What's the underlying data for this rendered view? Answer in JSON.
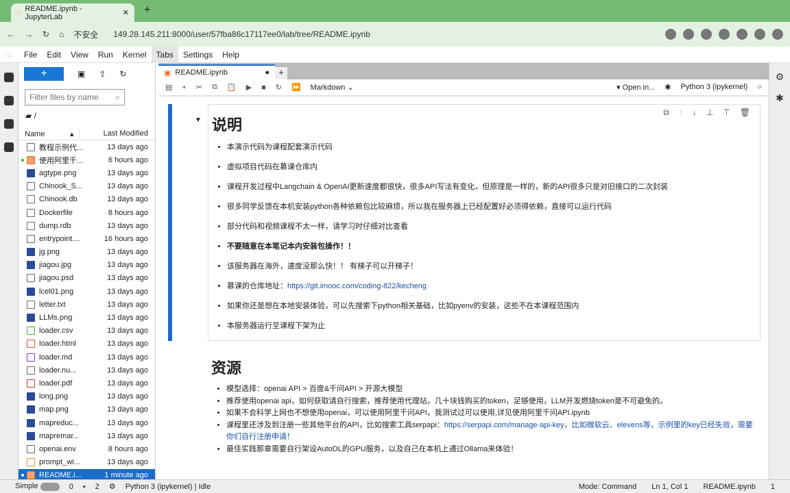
{
  "browser": {
    "tab_title": "README.ipynb - JupyterLab",
    "url": "149.28.145.211:8000/user/57fba86c17117ee0/lab/tree/README.ipynb",
    "security": "不安全"
  },
  "menu": [
    "File",
    "Edit",
    "View",
    "Run",
    "Kernel",
    "Tabs",
    "Settings",
    "Help"
  ],
  "filebrowser": {
    "new_label": "+",
    "filter_placeholder": "Filter files by name",
    "path": "/",
    "col_name": "Name",
    "col_modified": "Last Modified",
    "files": [
      {
        "name": "教程示例代...",
        "modified": "13 days ago",
        "type": "file"
      },
      {
        "name": "使用阿里千...",
        "modified": "6 hours ago",
        "type": "nb",
        "running": true
      },
      {
        "name": "agtype.png",
        "modified": "13 days ago",
        "type": "img"
      },
      {
        "name": "Chinook_S...",
        "modified": "13 days ago",
        "type": "file"
      },
      {
        "name": "Chinook.db",
        "modified": "13 days ago",
        "type": "file"
      },
      {
        "name": "Dockerfile",
        "modified": "8 hours ago",
        "type": "file"
      },
      {
        "name": "dump.rdb",
        "modified": "13 days ago",
        "type": "file"
      },
      {
        "name": "entrypoint....",
        "modified": "16 hours ago",
        "type": "file"
      },
      {
        "name": "jg.png",
        "modified": "13 days ago",
        "type": "img"
      },
      {
        "name": "jiagou.jpg",
        "modified": "13 days ago",
        "type": "img"
      },
      {
        "name": "jiagou.psd",
        "modified": "13 days ago",
        "type": "file"
      },
      {
        "name": "lcel01.png",
        "modified": "13 days ago",
        "type": "img"
      },
      {
        "name": "letter.txt",
        "modified": "13 days ago",
        "type": "file"
      },
      {
        "name": "LLMs.png",
        "modified": "13 days ago",
        "type": "img"
      },
      {
        "name": "loader.csv",
        "modified": "13 days ago",
        "type": "csv"
      },
      {
        "name": "loader.html",
        "modified": "13 days ago",
        "type": "html"
      },
      {
        "name": "loader.md",
        "modified": "13 days ago",
        "type": "md"
      },
      {
        "name": "loader.nu...",
        "modified": "13 days ago",
        "type": "file"
      },
      {
        "name": "loader.pdf",
        "modified": "13 days ago",
        "type": "pdf"
      },
      {
        "name": "long.png",
        "modified": "13 days ago",
        "type": "img"
      },
      {
        "name": "map.png",
        "modified": "13 days ago",
        "type": "img"
      },
      {
        "name": "mapreduc...",
        "modified": "13 days ago",
        "type": "img"
      },
      {
        "name": "mapremar...",
        "modified": "13 days ago",
        "type": "img"
      },
      {
        "name": "openai.env",
        "modified": "8 hours ago",
        "type": "file"
      },
      {
        "name": "prompt_wi...",
        "modified": "13 days ago",
        "type": "json"
      },
      {
        "name": "README.i...",
        "modified": "1 minute ago",
        "type": "nb",
        "running": true,
        "selected": true
      }
    ]
  },
  "notebook": {
    "tab": "README.ipynb",
    "cell_type": "Markdown",
    "open_in": "Open in...",
    "kernel": "Python 3 (ipykernel)",
    "h1": "说明",
    "items": [
      "本演示代码为课程配套演示代码",
      "虚拟项目代码在慕课仓库内",
      "课程开发过程中Langchain & OpenAI更新速度都很快，很多API写法有变化，但原理是一样的，新的API很多只是对旧接口的二次封装",
      "很多同学反馈在本机安装python各种依赖包比较麻烦，所以我在服务器上已经配置好必须得依赖，直接可以运行代码",
      "部分代码和视频课程不太一样，请学习时仔细对比查看",
      "不要随意在本笔记本内安装包操作！！",
      "该服务器在海外，速度没那么快！！ 有梯子可以开梯子！"
    ],
    "repo_label": "慕课的仓库地址：",
    "repo_link": "https://git.imooc.com/coding-822/kecheng",
    "items2": [
      "如果你还是想在本地安装体验，可以先搜索下python相关基础，比如pyenv的安装，这些不在本课程范围内",
      "本服务器运行至课程下架为止"
    ],
    "h2": "资源",
    "res": [
      "模型选择：openai API > 百度&千问API > 开源大模型",
      "推荐使用openai api，如何获取请自行搜索，推荐使用代理站，几十块钱购买的token，足够使用，LLM开发燃烧token是不可避免的。",
      "如果不会科学上网也不想使用openai，可以使用阿里千问API，我测试过可以使用,详见使用阿里千问API.ipynb"
    ],
    "res4_pre": "课程里还涉及到注册一些其他平台的API，比如搜索工具serpapi：",
    "res4_link": "https://serpapi.com/manage-api-key，比如微软云、elevens等，示例里的key已经失效，需要你们自行注册申请！",
    "res5": "最佳实践那章需要自行架设AutoDL的GPU服务，以及自己在本机上通过Ollama来体验！"
  },
  "status": {
    "mode_label": "Simple",
    "terminals": "0",
    "kernels": "2",
    "kernel": "Python 3 (ipykernel) | Idle",
    "mode": "Mode: Command",
    "pos": "Ln 1, Col 1",
    "file": "README.ipynb",
    "num": "1"
  }
}
